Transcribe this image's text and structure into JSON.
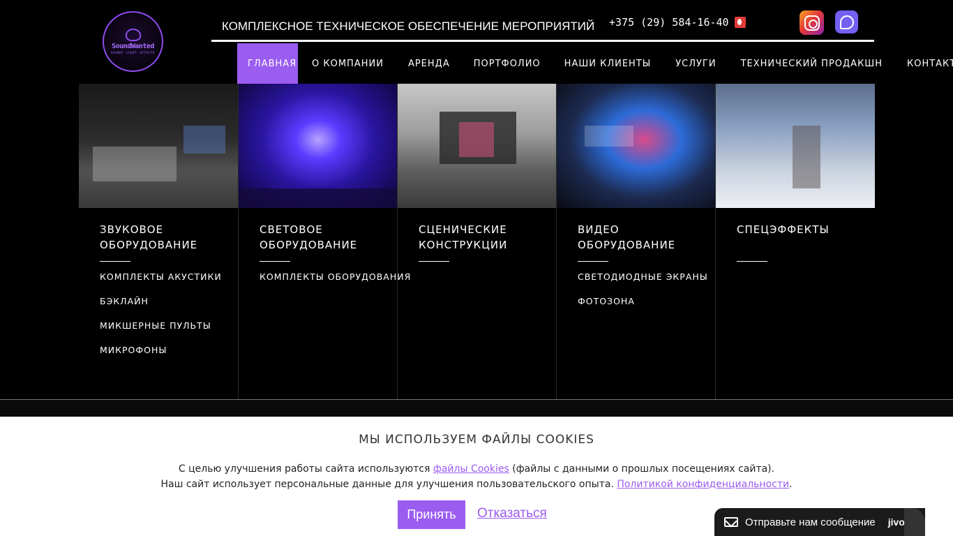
{
  "header": {
    "logo_text": "SoundWanted",
    "logo_sub": "SOUND · LIGHT · EFFECTS",
    "tagline": "КОМПЛЕКСНОЕ ТЕХНИЧЕСКОЕ ОБЕСПЕЧЕНИЕ МЕРОПРИЯТИЙ",
    "phone": "+375 (29) 584-16-40",
    "social": [
      "instagram-icon",
      "viber-icon"
    ]
  },
  "nav": {
    "items": [
      {
        "label": "ГЛАВНАЯ",
        "active": true
      },
      {
        "label": "О КОМПАНИИ"
      },
      {
        "label": "АРЕНДА"
      },
      {
        "label": "ПОРТФОЛИО"
      },
      {
        "label": "НАШИ КЛИЕНТЫ"
      },
      {
        "label": "УСЛУГИ"
      },
      {
        "label": "ТЕХНИЧЕСКИЙ ПРОДАКШН"
      },
      {
        "label": "КОНТАКТЫ"
      }
    ]
  },
  "categories": [
    {
      "title_line1": "ЗВУКОВОЕ",
      "title_line2": "ОБОРУДОВАНИЕ",
      "links": [
        "КОМПЛЕКТЫ АКУСТИКИ",
        "БЭКЛАЙН",
        "МИКШЕРНЫЕ ПУЛЬТЫ",
        "МИКРОФОНЫ"
      ]
    },
    {
      "title_line1": "СВЕТОВОЕ",
      "title_line2": "ОБОРУДОВАНИЕ",
      "links": [
        "КОМПЛЕКТЫ ОБОРУДОВАНИЯ"
      ]
    },
    {
      "title_line1": "СЦЕНИЧЕСКИЕ",
      "title_line2": "КОНСТРУКЦИИ",
      "links": []
    },
    {
      "title_line1": "ВИДЕО",
      "title_line2": "ОБОРУДОВАНИЕ",
      "links": [
        "СВЕТОДИОДНЫЕ ЭКРАНЫ",
        "ФОТОЗОНА"
      ]
    },
    {
      "title_line1": "СПЕЦЭФФЕКТЫ",
      "title_line2": "",
      "links": []
    }
  ],
  "cookie": {
    "title": "МЫ ИСПОЛЬЗУЕМ ФАЙЛЫ COOKIES",
    "line1_before": "С целью улучшения работы сайта используются ",
    "line1_link": "файлы Cookies",
    "line1_after": " (файлы с данными о прошлых посещениях сайта).",
    "line2_before": "Наш сайт использует персональные данные для улучшения пользовательского опыта. ",
    "line2_link": "Политикой конфиденциальности",
    "line2_after": ".",
    "accept_label": "Принять",
    "decline_label": "Отказаться"
  },
  "chat": {
    "text": "Отправьте нам сообщение",
    "brand": "jivo"
  },
  "colors": {
    "accent": "#9b5cf0",
    "background": "#000000"
  }
}
